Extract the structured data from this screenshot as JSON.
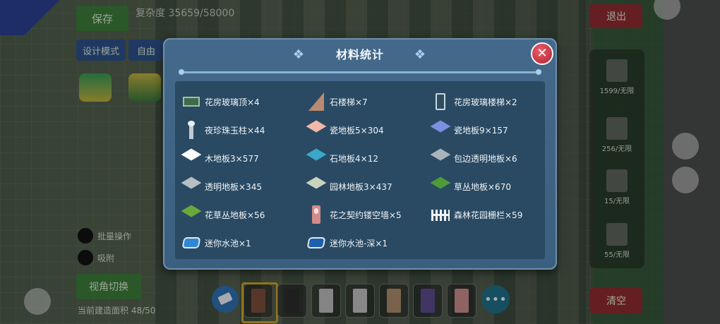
{
  "hud": {
    "save_label": "保存",
    "complexity_text": "复杂度 35659/58000",
    "design_mode_label": "设计模式",
    "free_mode_label": "自由",
    "exit_label": "退出",
    "clear_label": "清空",
    "switch_label": "视角切换",
    "toggle_1_label": "批量操作",
    "toggle_2_label": "吸附",
    "bottom_status_label": "当前建造面积 48/50",
    "right_items": [
      "1599/无限",
      "256/无限",
      "15/无限",
      "55/无限"
    ]
  },
  "dialog": {
    "title": "材料统计",
    "close_label": "✕",
    "items": [
      {
        "label": "花房玻璃顶×4",
        "icon": "glass-roof-icon"
      },
      {
        "label": "石楼梯×7",
        "icon": "stone-stairs-icon"
      },
      {
        "label": "花房玻璃楼梯×2",
        "icon": "glass-stairs-icon"
      },
      {
        "label": "夜珍珠玉柱×44",
        "icon": "pearl-pillar-icon"
      },
      {
        "label": "瓷地板5×304",
        "icon": "tile-floor-pink-icon",
        "color": "#f2b8a8"
      },
      {
        "label": "瓷地板9×157",
        "icon": "tile-floor-blue-icon",
        "color": "#7f8fe0"
      },
      {
        "label": "木地板3×577",
        "icon": "wood-floor-icon",
        "color": "#ffffff"
      },
      {
        "label": "石地板4×12",
        "icon": "stone-floor-icon",
        "color": "#3aa7c8"
      },
      {
        "label": "包边透明地板×6",
        "icon": "edged-glass-floor-icon",
        "color": "#a9b3bb"
      },
      {
        "label": "透明地板×345",
        "icon": "glass-floor-icon",
        "color": "#b7bec4"
      },
      {
        "label": "园林地板3×437",
        "icon": "garden-floor-icon",
        "color": "#c9d2bc"
      },
      {
        "label": "草丛地板×670",
        "icon": "grass-floor-icon",
        "color": "#4f9a3a"
      },
      {
        "label": "花草丛地板×56",
        "icon": "flower-grass-floor-icon",
        "color": "#6aa83c"
      },
      {
        "label": "花之契约镂空墙×5",
        "icon": "flower-wall-icon"
      },
      {
        "label": "森林花园栅栏×59",
        "icon": "fence-icon"
      },
      {
        "label": "迷你水池×1",
        "icon": "mini-pool-icon"
      },
      {
        "label": "迷你水池-深×1",
        "icon": "mini-pool-deep-icon"
      }
    ]
  },
  "toolbar": {
    "more_label": "•••",
    "slots": [
      "#7a4b3a",
      "#2b2b2b",
      "#b7b7b7",
      "#bdbdbd",
      "#a98a6a",
      "#cfcfcf",
      "#5a4a8a",
      "#c88a8a"
    ]
  }
}
